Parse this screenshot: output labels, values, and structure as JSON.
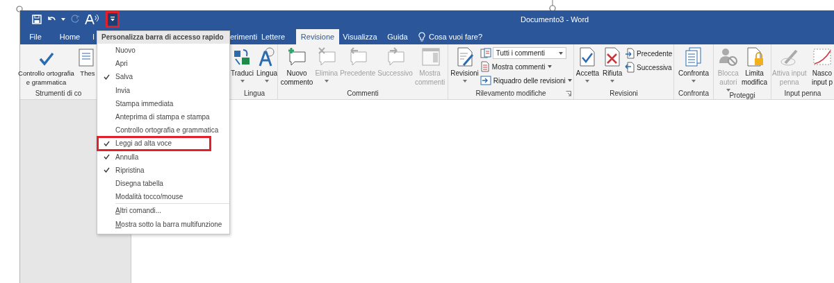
{
  "window": {
    "title": "Documento3  -  Word"
  },
  "quick_access": {
    "undo_has_menu": true,
    "redo_disabled": true,
    "customize_highlighted": true
  },
  "tabs": [
    {
      "label": "File",
      "selected": false
    },
    {
      "label": "Home",
      "selected": false
    },
    {
      "label": "I",
      "selected": false
    },
    {
      "label": "erimenti",
      "selected": false
    },
    {
      "label": "Lettere",
      "selected": false
    },
    {
      "label": "Revisione",
      "selected": true
    },
    {
      "label": "Visualizza",
      "selected": false
    },
    {
      "label": "Guida",
      "selected": false
    }
  ],
  "search": {
    "placeholder": "Cosa vuoi fare?"
  },
  "ribbon": {
    "groups": [
      {
        "label": "Strumenti di co",
        "items": [
          {
            "kind": "large",
            "lines": [
              "Controllo ortografia",
              "e grammatica"
            ],
            "disabled": false,
            "has_menu": false
          },
          {
            "kind": "large",
            "lines": [
              "Thes"
            ],
            "disabled": false,
            "has_menu": false
          }
        ]
      },
      {
        "label": "Lingua",
        "items": [
          {
            "kind": "large",
            "lines": [
              "Traduci"
            ],
            "disabled": false,
            "has_menu": true
          },
          {
            "kind": "large",
            "lines": [
              "Lingua"
            ],
            "disabled": false,
            "has_menu": true
          }
        ]
      },
      {
        "label": "Commenti",
        "items": [
          {
            "kind": "large",
            "lines": [
              "Nuovo",
              "commento"
            ],
            "disabled": false,
            "has_menu": false
          },
          {
            "kind": "large",
            "lines": [
              "Elimina"
            ],
            "disabled": true,
            "has_menu": true
          },
          {
            "kind": "large",
            "lines": [
              "Precedente"
            ],
            "disabled": true,
            "has_menu": false
          },
          {
            "kind": "large",
            "lines": [
              "Successivo"
            ],
            "disabled": true,
            "has_menu": false
          },
          {
            "kind": "large",
            "lines": [
              "Mostra",
              "commenti"
            ],
            "disabled": true,
            "has_menu": false
          }
        ]
      },
      {
        "label": "Rilevamento modifiche",
        "dialog_launcher": true,
        "items": [
          {
            "kind": "large",
            "lines": [
              "Revisioni"
            ],
            "disabled": false,
            "has_menu": true
          },
          {
            "kind": "stack",
            "buttons": [
              {
                "kind": "field",
                "label": "Tutti i commenti",
                "has_menu": true
              },
              {
                "kind": "small",
                "label": "Mostra commenti",
                "has_menu": true
              },
              {
                "kind": "small",
                "label": "Riquadro delle revisioni",
                "has_menu": true
              }
            ]
          }
        ]
      },
      {
        "label": "Revisioni",
        "items": [
          {
            "kind": "large",
            "lines": [
              "Accetta"
            ],
            "disabled": false,
            "has_menu": true
          },
          {
            "kind": "large",
            "lines": [
              "Rifiuta"
            ],
            "disabled": false,
            "has_menu": true
          },
          {
            "kind": "stack",
            "buttons": [
              {
                "kind": "small",
                "label": "Precedente",
                "has_menu": false
              },
              {
                "kind": "small",
                "label": "Successiva",
                "has_menu": false
              }
            ]
          }
        ]
      },
      {
        "label": "Confronta",
        "items": [
          {
            "kind": "large",
            "lines": [
              "Confronta"
            ],
            "disabled": false,
            "has_menu": true
          }
        ]
      },
      {
        "label": "Proteggi",
        "items": [
          {
            "kind": "large",
            "lines": [
              "Blocca",
              "autori"
            ],
            "disabled": true,
            "has_menu": true
          },
          {
            "kind": "large",
            "lines": [
              "Limita",
              "modifica"
            ],
            "disabled": false,
            "has_menu": false
          }
        ]
      },
      {
        "label": "Input penna",
        "items": [
          {
            "kind": "large",
            "lines": [
              "Attiva input",
              "penna"
            ],
            "disabled": true,
            "has_menu": false
          },
          {
            "kind": "large",
            "lines": [
              "Nasco",
              "input p"
            ],
            "disabled": false,
            "has_menu": false
          }
        ]
      }
    ]
  },
  "menu": {
    "title": "Personalizza barra di accesso rapido",
    "items": [
      {
        "kind": "option",
        "label": "Nuovo",
        "checked": false,
        "highlighted": false
      },
      {
        "kind": "option",
        "label": "Apri",
        "checked": false,
        "highlighted": false
      },
      {
        "kind": "option",
        "label": "Salva",
        "checked": true,
        "highlighted": false
      },
      {
        "kind": "option",
        "label": "Invia",
        "checked": false,
        "highlighted": false
      },
      {
        "kind": "option",
        "label": "Stampa immediata",
        "checked": false,
        "highlighted": false
      },
      {
        "kind": "option",
        "label": "Anteprima di stampa e stampa",
        "checked": false,
        "highlighted": false
      },
      {
        "kind": "option",
        "label": "Controllo ortografia e grammatica",
        "checked": false,
        "highlighted": false
      },
      {
        "kind": "option",
        "label": "Leggi ad alta voce",
        "checked": true,
        "highlighted": true
      },
      {
        "kind": "option",
        "label": "Annulla",
        "checked": true,
        "highlighted": false
      },
      {
        "kind": "option",
        "label": "Ripristina",
        "checked": true,
        "highlighted": false
      },
      {
        "kind": "option",
        "label": "Disegna tabella",
        "checked": false,
        "highlighted": false
      },
      {
        "kind": "option",
        "label": "Modalità tocco/mouse",
        "checked": false,
        "highlighted": false
      },
      {
        "kind": "command",
        "label": "Altri comandi...",
        "highlighted": false
      },
      {
        "kind": "command",
        "label": "Mostra sotto la barra multifunzione",
        "highlighted": false
      }
    ]
  }
}
